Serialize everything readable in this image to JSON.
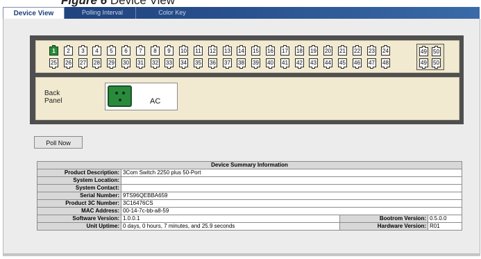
{
  "caption": {
    "figure_label": "Figure 6",
    "title": "Device View"
  },
  "tabs": [
    {
      "label": "Device View",
      "active": true
    },
    {
      "label": "Polling Interval",
      "active": false
    },
    {
      "label": "Color Key",
      "active": false
    }
  ],
  "front_panel": {
    "top_ports": [
      "1",
      "2",
      "3",
      "4",
      "5",
      "6",
      "7",
      "8",
      "9",
      "10",
      "11",
      "12",
      "13",
      "14",
      "15",
      "16",
      "17",
      "18",
      "19",
      "20",
      "21",
      "22",
      "23",
      "24"
    ],
    "bottom_ports": [
      "25",
      "26",
      "27",
      "28",
      "29",
      "30",
      "31",
      "32",
      "33",
      "34",
      "35",
      "36",
      "37",
      "38",
      "39",
      "40",
      "41",
      "42",
      "43",
      "44",
      "45",
      "46",
      "47",
      "48"
    ],
    "sfp_top": [
      "49",
      "50"
    ],
    "sfp_bottom": [
      "49",
      "50"
    ],
    "active_port": "1",
    "active_color": "#2a8a3c"
  },
  "back_panel": {
    "label_line1": "Back",
    "label_line2": "Panel",
    "power_label": "AC"
  },
  "poll_button": {
    "label": "Poll Now"
  },
  "summary": {
    "header": "Device Summary Information",
    "rows": [
      {
        "label": "Product Description:",
        "value": "3Com Switch 2250 plus 50-Port"
      },
      {
        "label": "System Location:",
        "value": ""
      },
      {
        "label": "System Contact:",
        "value": ""
      },
      {
        "label": "Serial Number:",
        "value": "9TS96QEBBA659"
      },
      {
        "label": "Product 3C Number:",
        "value": "3C16476CS"
      },
      {
        "label": "MAC Address:",
        "value": "00-14-7c-bb-a8-59"
      }
    ],
    "split_rows": [
      {
        "label": "Software Version:",
        "value": "1.0.0.1",
        "label2": "Bootrom Version:",
        "value2": "0.5.0.0"
      },
      {
        "label": "Unit Uptime:",
        "value": "0 days, 0 hours, 7 minutes, and 25.9 seconds",
        "label2": "Hardware Version:",
        "value2": "R01"
      }
    ]
  }
}
